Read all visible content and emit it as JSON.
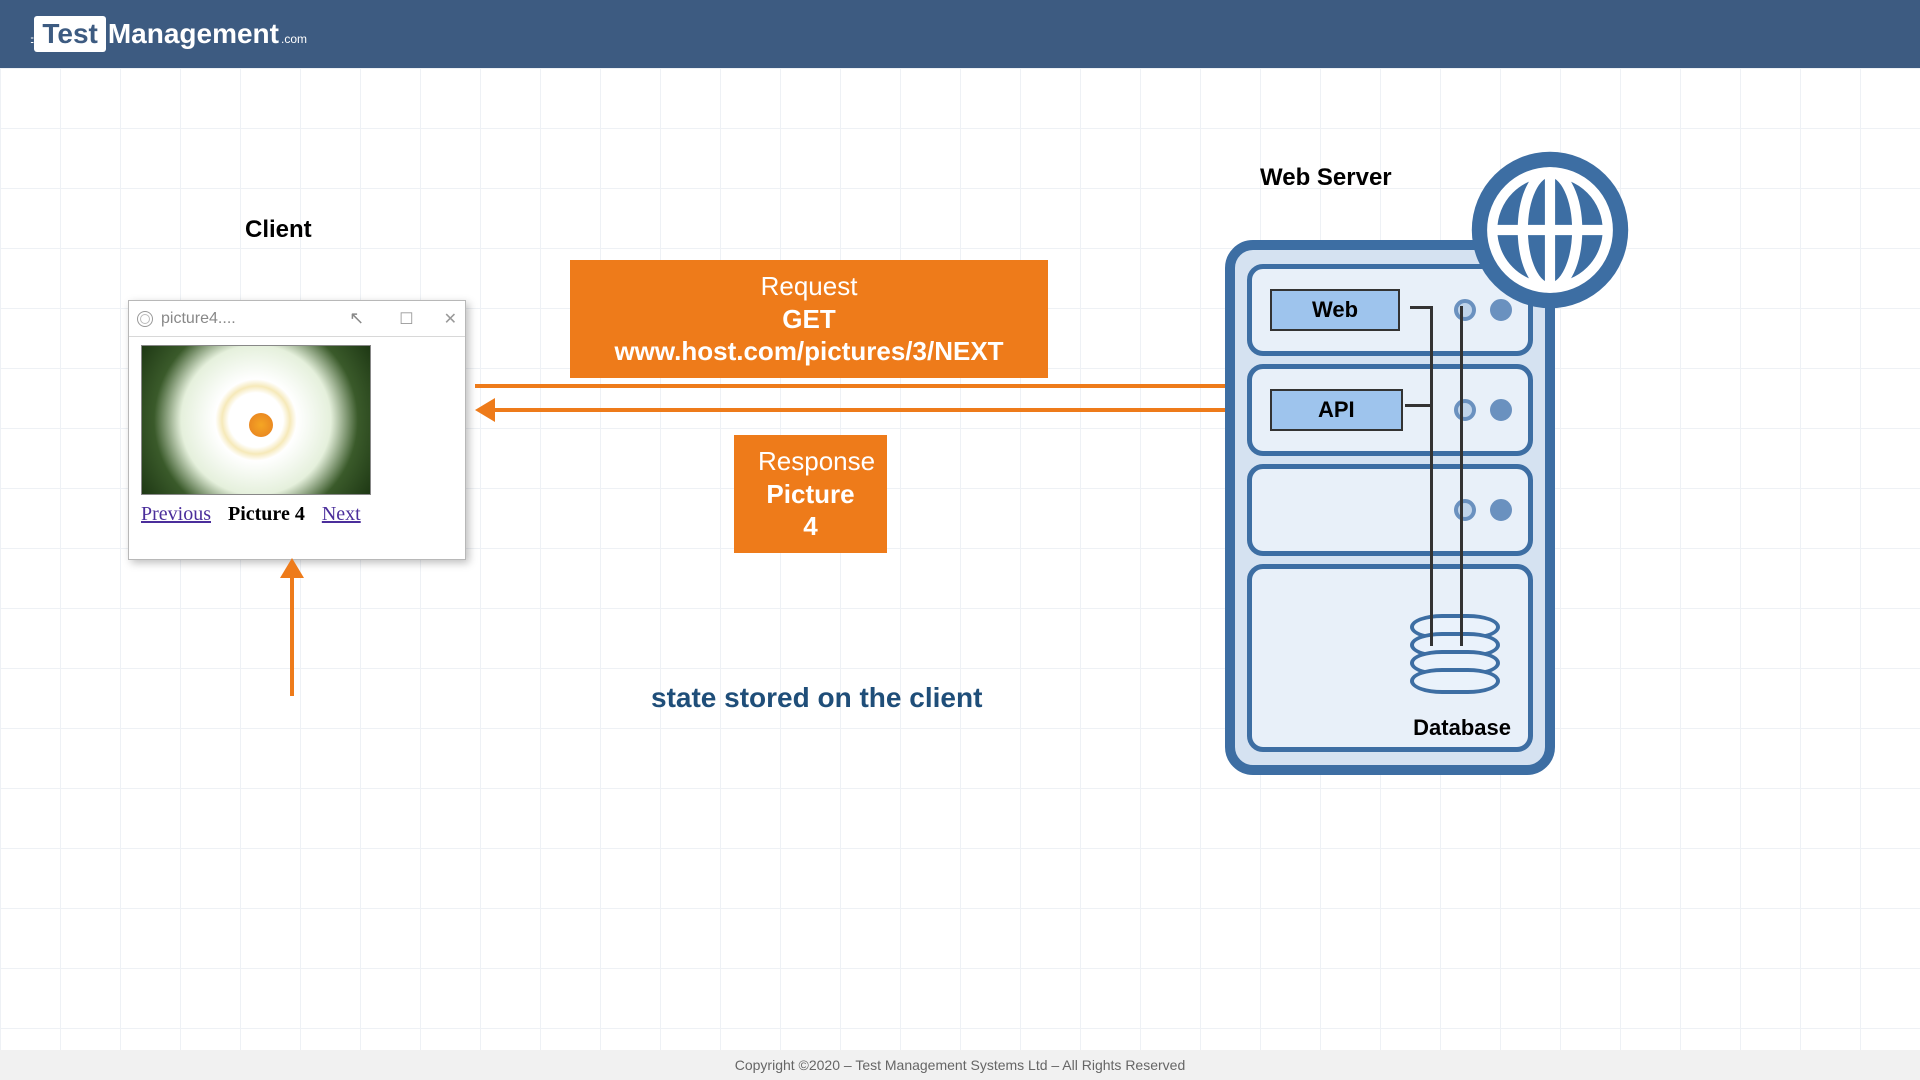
{
  "logo": {
    "test": "Test",
    "mgmt": "Management",
    "suffix": ".com"
  },
  "labels": {
    "client": "Client",
    "server": "Web Server",
    "database": "Database"
  },
  "browser": {
    "tab_title": "picture4....",
    "prev": "Previous",
    "current": "Picture 4",
    "next": "Next"
  },
  "request": {
    "title": "Request",
    "line": "GET www.host.com/pictures/3/NEXT"
  },
  "response": {
    "title": "Response",
    "line": "Picture 4"
  },
  "caption": "state stored on the client",
  "server_units": {
    "web": "Web",
    "api": "API"
  },
  "footer": "Copyright ©2020 – Test Management Systems Ltd – All Rights Reserved"
}
